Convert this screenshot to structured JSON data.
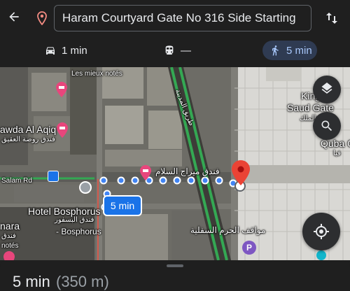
{
  "search": {
    "destination": "Haram Courtyard Gate No 316 Side Starting"
  },
  "icons": {
    "back": "back-arrow-icon",
    "destination": "location-pin-icon",
    "swap": "swap-vertical-icon",
    "drive": "car-icon",
    "transit": "train-icon",
    "walk": "walking-person-icon",
    "layers": "layers-icon",
    "search": "search-icon",
    "locate": "my-location-icon",
    "parking": "parking-icon"
  },
  "modes": {
    "drive": "1 min",
    "transit": "—",
    "walk": "5 min",
    "selected": "walk"
  },
  "map": {
    "labels": {
      "les_mieux": "Les mieux notés",
      "king_saud_1": "King",
      "king_saud_2": "Saud Gate",
      "king_saud_ar": "الملك",
      "rawda_en": "awda Al Aqiq",
      "rawda_ar": "فندق روضة العقيق",
      "salam_rd": "Salam Rd",
      "miraj_ar": "فندق ميراج السلام",
      "quba_1": "Quba G",
      "quba_ar": "قبا",
      "bosphorus_en": "Hotel Bosphorus",
      "bosphorus_ar": "فندق البسفور",
      "bosphorus_sub": "- Bosphorus",
      "manara": "nara",
      "manara_ar": "فندق",
      "notes": "notés",
      "parking_ar": "مواقف الحرم السفلية",
      "road_ar": "طريق المدينة"
    },
    "eta": "5 min",
    "colors": {
      "route": "#1a73e8",
      "destination_pin": "#ea4335",
      "hotel_marker": "#e8467c",
      "accent": "#a8c7fa"
    }
  },
  "sheet": {
    "time": "5 min",
    "distance": "(350 m)"
  }
}
